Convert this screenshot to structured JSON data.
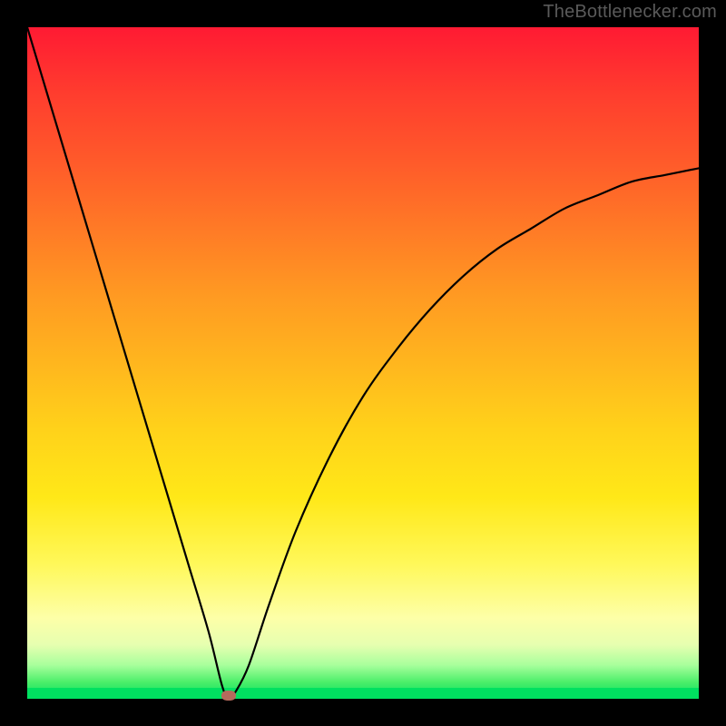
{
  "watermark": {
    "text": "TheBottlenecker.com"
  },
  "chart_data": {
    "type": "line",
    "title": "",
    "xlabel": "",
    "ylabel": "",
    "xlim": [
      0,
      100
    ],
    "ylim": [
      0,
      100
    ],
    "grid": false,
    "legend": false,
    "series": [
      {
        "name": "bottleneck-curve",
        "x": [
          0,
          3,
          6,
          9,
          12,
          15,
          18,
          21,
          24,
          27,
          29,
          30,
          31,
          33,
          36,
          40,
          45,
          50,
          55,
          60,
          65,
          70,
          75,
          80,
          85,
          90,
          95,
          100
        ],
        "values": [
          100,
          90,
          80,
          70,
          60,
          50,
          40,
          30,
          20,
          10,
          2,
          0,
          1,
          5,
          14,
          25,
          36,
          45,
          52,
          58,
          63,
          67,
          70,
          73,
          75,
          77,
          78,
          79
        ]
      }
    ],
    "marker": {
      "x": 30,
      "y": 0,
      "color": "#b56a5c"
    },
    "background_gradient": {
      "top": "#ff1a33",
      "mid": "#ffd21a",
      "bottom": "#00e060"
    },
    "annotations": []
  }
}
